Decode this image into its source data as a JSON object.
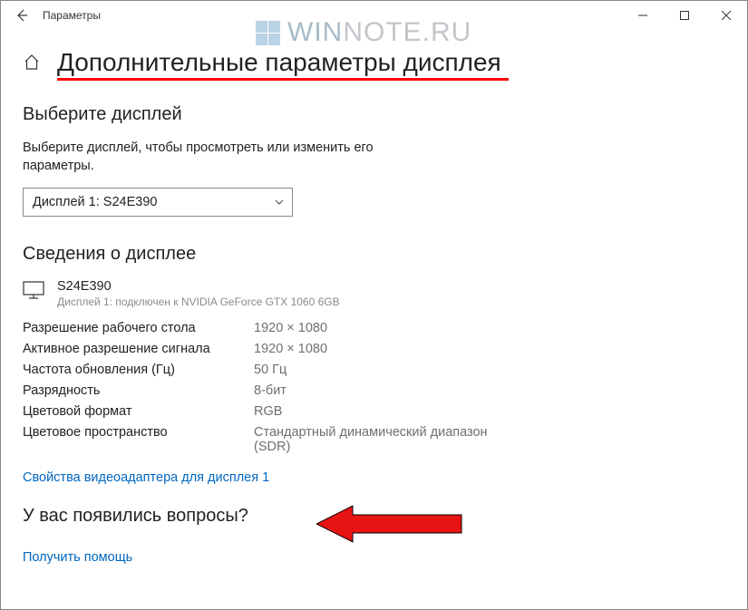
{
  "window": {
    "title": "Параметры"
  },
  "watermark": {
    "text1": "WIN",
    "text2": "NOTE.RU"
  },
  "page": {
    "title": "Дополнительные параметры дисплея"
  },
  "select_display": {
    "heading": "Выберите дисплей",
    "instruction": "Выберите дисплей, чтобы просмотреть или изменить его параметры.",
    "dropdown_value": "Дисплей 1: S24E390"
  },
  "info": {
    "heading": "Сведения о дисплее",
    "display_name": "S24E390",
    "display_sub": "Дисплей 1: подключен к NVIDIA GeForce GTX 1060 6GB",
    "rows": [
      {
        "k": "Разрешение рабочего стола",
        "v": "1920 × 1080"
      },
      {
        "k": "Активное разрешение сигнала",
        "v": "1920 × 1080"
      },
      {
        "k": "Частота обновления (Гц)",
        "v": "50 Гц"
      },
      {
        "k": "Разрядность",
        "v": "8-бит"
      },
      {
        "k": "Цветовой формат",
        "v": "RGB"
      },
      {
        "k": "Цветовое пространство",
        "v": "Стандартный динамический диапазон (SDR)"
      }
    ],
    "adapter_link": "Свойства видеоадаптера для дисплея 1"
  },
  "help": {
    "heading": "У вас появились вопросы?",
    "link": "Получить помощь"
  }
}
